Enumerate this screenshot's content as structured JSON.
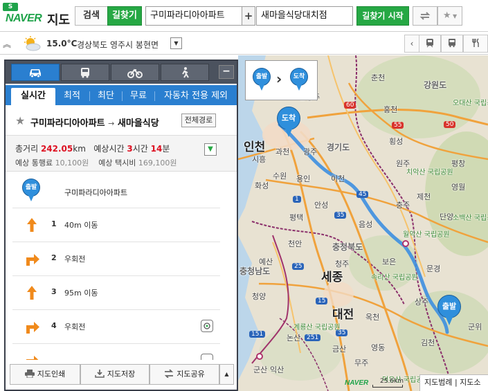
{
  "app": {
    "logo_badge": "S",
    "logo_brand": "NAVER",
    "logo_title": "지도"
  },
  "topbar": {
    "search_tab": "검색",
    "route_tab": "길찾기",
    "start_value": "구미파라디아아파트",
    "plus": "+",
    "end_value": "새마을식당대치점",
    "go_button": "길찾기 시작",
    "swap_icon": "refresh-arrow-icon",
    "favorite_icon": "star-icon"
  },
  "weather": {
    "icon": "sun-cloud-icon",
    "temperature": "15.0°C",
    "location": "경상북도 영주시 봉현면"
  },
  "map": {
    "labels": {
      "chuncheon": "춘천",
      "gangwon": "강원도",
      "hongcheon": "홍천",
      "namyangju": "남양주",
      "incheon": "인천",
      "gwacheon": "과천",
      "gwangju": "광주",
      "gyeonggi": "경기도",
      "hoengseong": "횡성",
      "wonju": "원주",
      "siheung": "시흥",
      "hwaseong": "화성",
      "suwon": "수원",
      "yongin": "용인",
      "icheon": "이천",
      "pyeongchang": "평창",
      "yeongwol": "영월",
      "pyeongtaek": "평택",
      "anseong": "안성",
      "chungju": "충주",
      "jecheon": "제천",
      "danyang": "단양",
      "cheonan": "천안",
      "eumseong": "음성",
      "chungbuk": "충청북도",
      "chungnam": "충청남도",
      "yesan": "예산",
      "cheongju": "청주",
      "sejong": "세종",
      "boeun": "보은",
      "mungyeong": "문경",
      "sangju": "상주",
      "cheongyang": "청양",
      "daejeon": "대전",
      "okcheon": "옥천",
      "yeongdong": "영동",
      "gimcheon": "김천",
      "nonsan": "논산",
      "geumsan": "금산",
      "gunsan": "군산",
      "iksan": "익산",
      "muju": "무주",
      "gunwi": "군위",
      "sobaek_park": "소백산 국립공원",
      "woraksan_park": "월악산 국립공원",
      "songnisan_park": "속리산 국립공원",
      "chiaksan_park": "치악산 국립공원",
      "odaesan_park": "오대산 국립공원",
      "gyeryongsan_park": "계룡산 국립공원",
      "deogyusan_park": "덕유산 국립공원",
      "road_1": "1",
      "road_15": "15",
      "road_25": "25",
      "road_35": "35",
      "road_45": "45",
      "road_50": "50",
      "road_55": "55",
      "road_60": "60",
      "road_251": "251",
      "road_151": "151"
    },
    "preview_start": "출발",
    "preview_end": "도착",
    "end_pin": "도착",
    "start_pin": "출발",
    "brand": "NAVER",
    "scale": "25.6km",
    "footer": "지도범례 | 지도소"
  },
  "panel": {
    "modes": [
      "car-icon",
      "bus-icon",
      "bicycle-icon",
      "walk-icon"
    ],
    "minimize": "−",
    "options": [
      "실시간",
      "최적",
      "최단",
      "무료",
      "자동차 전용 제외"
    ],
    "route_title_start": "구미파라디아아파트",
    "route_title_arrow": "→",
    "route_title_end": "새마을식당",
    "full_route_button": "전체경로",
    "summary": {
      "total_label": "총거리",
      "total_value": "242.05",
      "total_unit": "km",
      "time_label": "예상시간",
      "time_hours": "3",
      "time_h_unit": "시간",
      "time_minutes": "14",
      "time_m_unit": "분",
      "toll_label": "예상 통행료",
      "toll_value": "10,100원",
      "taxi_label": "예상 택시비",
      "taxi_value": "169,100원"
    },
    "start_pin": "출발",
    "start_name": "구미파라디아아파트",
    "steps": [
      {
        "num": "1",
        "text": "40m 이동",
        "dir": "straight-arrow-icon"
      },
      {
        "num": "2",
        "text": "우회전",
        "dir": "right-turn-arrow-icon"
      },
      {
        "num": "3",
        "text": "95m 이동",
        "dir": "straight-arrow-icon"
      },
      {
        "num": "4",
        "text": "우회전",
        "dir": "right-turn-arrow-icon"
      }
    ],
    "bottom": {
      "print": "지도인쇄",
      "save": "지도저장",
      "share": "지도공유"
    }
  },
  "colors": {
    "green": "#26a844",
    "blue": "#2a7fd0",
    "route": "#3d8fe0",
    "dark_tabs": "#4b525e",
    "orange_arrow": "#f08a1c",
    "red_text": "#dd1122"
  }
}
